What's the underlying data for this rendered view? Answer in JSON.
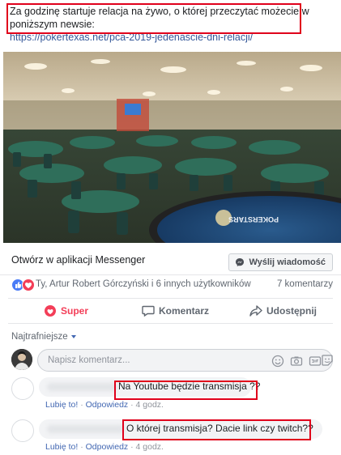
{
  "post": {
    "text": "Za godzinę startuje relacja na żywo, o której przeczytać możecie w poniższym newsie:",
    "link": "https://pokertexas.net/pca-2019-jedenascie-dni-relacji/"
  },
  "photo": {
    "table_logo": "POKERSTARS"
  },
  "link_bar": {
    "open_label": "Otwórz w aplikacji Messenger",
    "send_button": "Wyślij wiadomość"
  },
  "reactions": {
    "summary": "Ty, Artur Robert Górczyński i 6 innych użytkowników",
    "comments_count": "7 komentarzy"
  },
  "actions": {
    "super": "Super",
    "comment": "Komentarz",
    "share": "Udostępnij"
  },
  "comments_section": {
    "sort_label": "Najtrafniejsze",
    "composer_placeholder": "Napisz komentarz..."
  },
  "comments": [
    {
      "text": "Na Youtube będzie transmisja ??",
      "like": "Lubię to!",
      "reply": "Odpowiedz",
      "time": "4 godz."
    },
    {
      "text": "O której transmisja? Dacie link czy twitch??",
      "like": "Lubię to!",
      "reply": "Odpowiedz",
      "time": "4 godz."
    }
  ],
  "colors": {
    "annotation_red": "#e0001b",
    "link_blue": "#365899",
    "super_red": "#f33e58",
    "fb_blue": "#4267b2"
  }
}
